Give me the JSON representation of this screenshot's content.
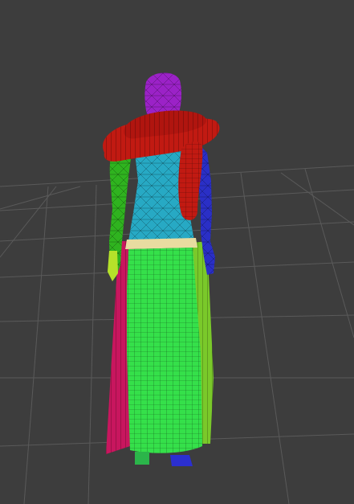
{
  "viewport": {
    "background_color": "#3d3d3d",
    "grid_color": "#5a5a5a",
    "grid_visible": true,
    "shading": "wireframe-on-shaded"
  },
  "scene_object": {
    "type": "clothed-mannequin",
    "parts": [
      {
        "name": "head",
        "color": "#9b22c7"
      },
      {
        "name": "torso-top",
        "color": "#27a9c4"
      },
      {
        "name": "scarf-coil",
        "color": "#c11a12"
      },
      {
        "name": "left-arm",
        "color": "#2fb31f"
      },
      {
        "name": "right-arm",
        "color": "#2a2fc6"
      },
      {
        "name": "waistband",
        "color": "#e8dca0"
      },
      {
        "name": "skirt-front",
        "color": "#35e04a"
      },
      {
        "name": "skirt-back-left",
        "color": "#c8165e"
      },
      {
        "name": "skirt-back-right",
        "color": "#7ac92a"
      },
      {
        "name": "feet",
        "color": "#2b2fd0"
      }
    ]
  }
}
